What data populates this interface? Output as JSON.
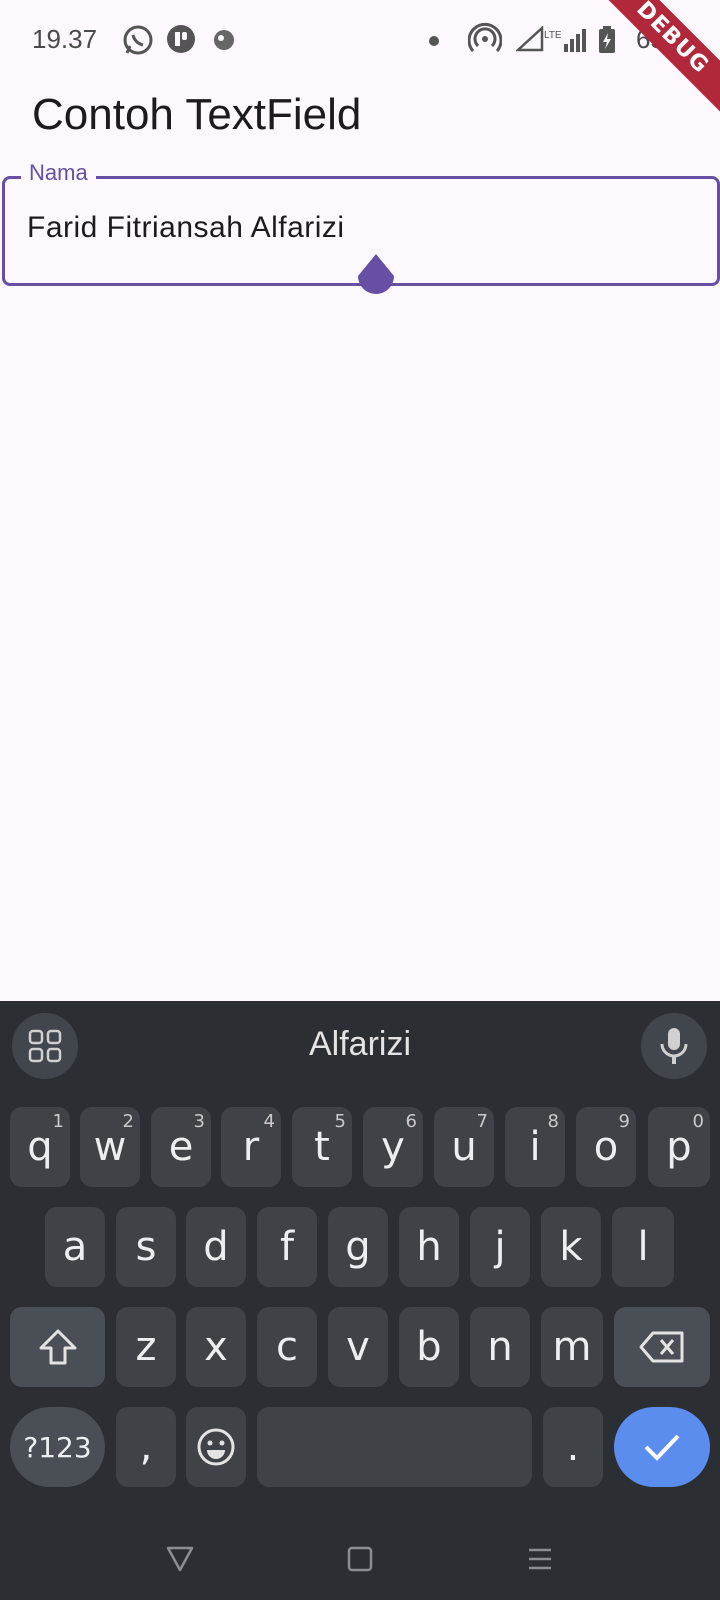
{
  "status_bar": {
    "time": "19.37",
    "icons": [
      "whatsapp-icon",
      "app-icon",
      "vpn-icon",
      "dot-icon",
      "hotspot-icon",
      "signal-lte-icon",
      "signal-icon",
      "battery-icon"
    ],
    "battery_text": "65%"
  },
  "debug_banner": "DEBUG",
  "app_bar": {
    "title": "Contoh TextField"
  },
  "text_field": {
    "label": "Nama",
    "value": "Farid Fitriansah Alfarizi",
    "accent_color": "#6750a4"
  },
  "keyboard": {
    "suggestion": "Alfarizi",
    "row1": [
      {
        "key": "q",
        "hint": "1"
      },
      {
        "key": "w",
        "hint": "2"
      },
      {
        "key": "e",
        "hint": "3"
      },
      {
        "key": "r",
        "hint": "4"
      },
      {
        "key": "t",
        "hint": "5"
      },
      {
        "key": "y",
        "hint": "6"
      },
      {
        "key": "u",
        "hint": "7"
      },
      {
        "key": "i",
        "hint": "8"
      },
      {
        "key": "o",
        "hint": "9"
      },
      {
        "key": "p",
        "hint": "0"
      }
    ],
    "row2": [
      "a",
      "s",
      "d",
      "f",
      "g",
      "h",
      "j",
      "k",
      "l"
    ],
    "row3": [
      "z",
      "x",
      "c",
      "v",
      "b",
      "n",
      "m"
    ],
    "symbols_label": "?123",
    "comma_label": ",",
    "period_label": ".",
    "enter_color": "#5b8def"
  },
  "nav_bar": {
    "items": [
      "back-icon",
      "home-icon",
      "recents-icon"
    ]
  }
}
